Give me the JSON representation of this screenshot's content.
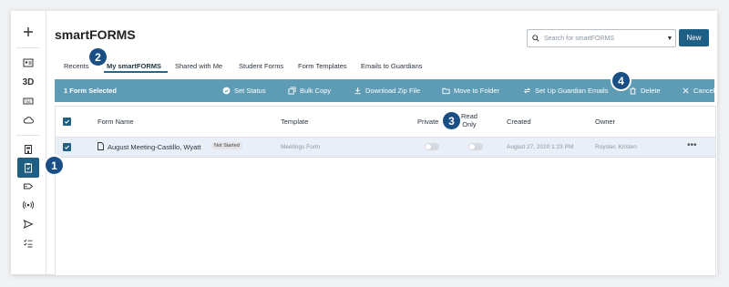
{
  "header": {
    "title": "smartFORMS",
    "search_placeholder": "Search for smartFORMS",
    "new_label": "New"
  },
  "rail": {
    "items": [
      "plus-icon",
      "id-card-icon",
      "3d-icon",
      "keyboard-icon",
      "cloud-icon",
      "building-icon",
      "clipboard-icon",
      "tag-icon",
      "broadcast-icon",
      "send-icon",
      "checklist-icon"
    ],
    "label_3d": "3D"
  },
  "tabs": [
    {
      "label": "Recents"
    },
    {
      "label": "My smartFORMS"
    },
    {
      "label": "Shared with Me"
    },
    {
      "label": "Student Forms"
    },
    {
      "label": "Form Templates"
    },
    {
      "label": "Emails to Guardians"
    }
  ],
  "action_bar": {
    "selected": "1 Form Selected",
    "set_status": "Set Status",
    "bulk_copy": "Bulk Copy",
    "download_zip": "Download Zip File",
    "move_to_folder": "Move to Folder",
    "guardian_emails": "Set Up Guardian Emails",
    "delete": "Delete",
    "cancel": "Cancel"
  },
  "table": {
    "headers": {
      "form_name": "Form Name",
      "template": "Template",
      "private": "Private",
      "read": "Read",
      "only": "Only",
      "created": "Created",
      "owner": "Owner"
    },
    "rows": [
      {
        "name": "August Meeting-Castillo, Wyatt",
        "status": "Not Started",
        "template": "Meetings Form",
        "created": "August 27, 2020 1:23 PM",
        "owner": "Royster, Kristen",
        "more": "•••"
      }
    ]
  },
  "callouts": {
    "one": "1",
    "two": "2",
    "three": "3",
    "four": "4"
  },
  "colors": {
    "accent": "#1f5f82",
    "action_bar": "#5e9cb5",
    "callout": "#1a4f86",
    "row_selected": "#e9eff7"
  }
}
